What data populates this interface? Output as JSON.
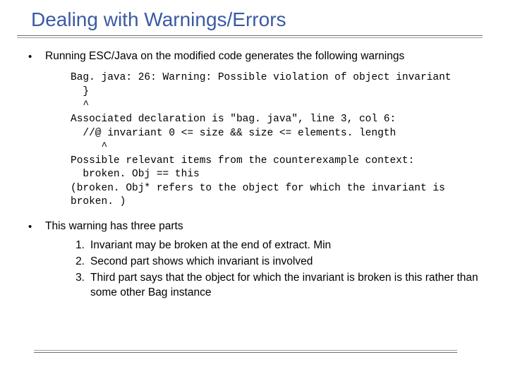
{
  "title": "Dealing with Warnings/Errors",
  "bullets": [
    {
      "text": "Running ESC/Java on the modified code generates the following warnings"
    },
    {
      "text": "This warning has three parts",
      "items": [
        "Invariant may be broken at the end of extract. Min",
        "Second part shows which invariant is involved",
        "Third part says that the object for which the invariant is broken is this rather than some other Bag instance"
      ]
    }
  ],
  "code_lines": [
    "Bag. java: 26: Warning: Possible violation of object invariant",
    "  }",
    "  ^",
    "Associated declaration is \"bag. java\", line 3, col 6:",
    "  //@ invariant 0 <= size && size <= elements. length",
    "     ^",
    "Possible relevant items from the counterexample context:",
    "  broken. Obj == this",
    "(broken. Obj* refers to the object for which the invariant is",
    "broken. )"
  ],
  "numbers": [
    "1.",
    "2.",
    "3."
  ]
}
